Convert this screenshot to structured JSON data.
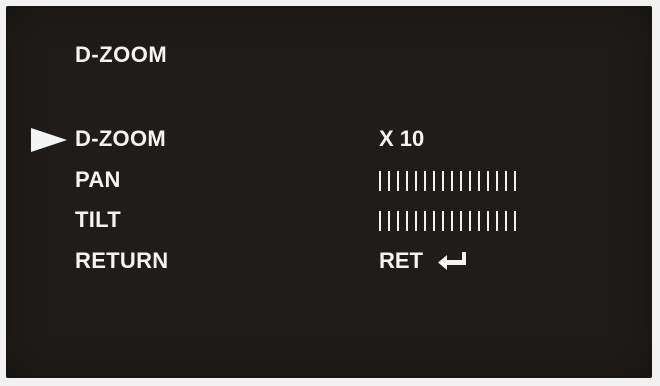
{
  "osd": {
    "title": "D-ZOOM",
    "menu": [
      {
        "label": "D-ZOOM",
        "value": "X 10",
        "selected": true
      },
      {
        "label": "PAN",
        "level_ticks": 16
      },
      {
        "label": "TILT",
        "level_ticks": 16
      },
      {
        "label": "RETURN",
        "value": "RET",
        "icon": "enter-return-icon"
      }
    ],
    "colors": {
      "background": "#1f1c19",
      "text": "#f4f4f4"
    }
  }
}
